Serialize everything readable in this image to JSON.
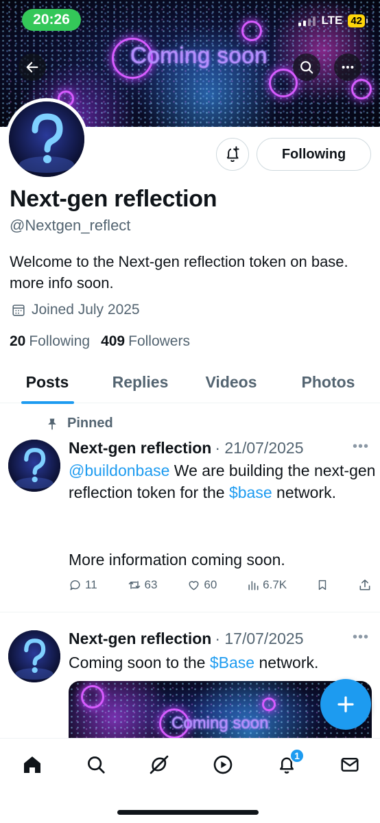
{
  "status_bar": {
    "time": "20:26",
    "network": "LTE",
    "battery": "42"
  },
  "banner": {
    "text": "Coming soon"
  },
  "profile": {
    "display_name": "Next-gen reflection",
    "handle": "@Nextgen_reflect",
    "bio": "Welcome to the Next-gen reflection token on base. more info soon.",
    "joined": "Joined July 2025",
    "following_count": "20",
    "following_label": "Following",
    "followers_count": "409",
    "followers_label": "Followers",
    "follow_button_label": "Following"
  },
  "tabs": [
    {
      "label": "Posts",
      "active": true
    },
    {
      "label": "Replies",
      "active": false
    },
    {
      "label": "Videos",
      "active": false
    },
    {
      "label": "Photos",
      "active": false
    }
  ],
  "posts": [
    {
      "pinned_label": "Pinned",
      "author": "Next-gen reflection",
      "date": "· 21/07/2025",
      "mention": "@buildonbase",
      "text_part1": " We are building the next-gen reflection token for the ",
      "cashtag": "$base",
      "text_part2": " network.",
      "text_para2": "More information coming soon.",
      "replies": "11",
      "reposts": "63",
      "likes": "60",
      "views": "6.7K"
    },
    {
      "author": "Next-gen reflection",
      "date": "· 17/07/2025",
      "text_part1": "Coming soon to the ",
      "cashtag": "$Base",
      "text_part2": " network.",
      "media_text": "Coming soon"
    }
  ],
  "nav": {
    "notifications_badge": "1"
  },
  "colors": {
    "accent": "#1d9bf0",
    "text_primary": "#0f1419",
    "text_secondary": "#536471",
    "status_green": "#34c759",
    "battery_yellow": "#ffd60a"
  }
}
